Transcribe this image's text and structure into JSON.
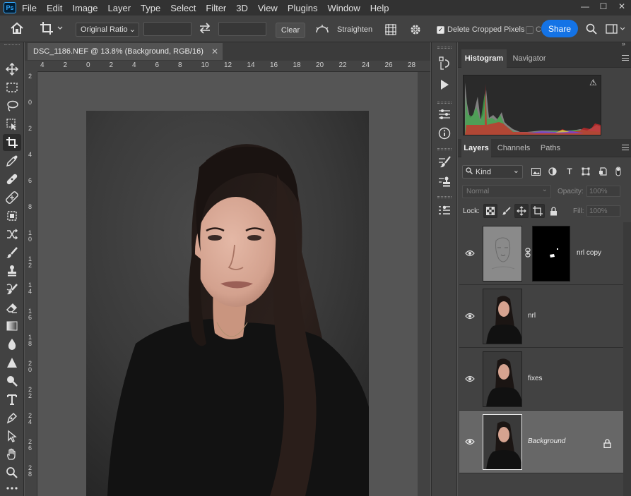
{
  "app": {
    "logo": "Ps",
    "menu": [
      "File",
      "Edit",
      "Image",
      "Layer",
      "Type",
      "Select",
      "Filter",
      "3D",
      "View",
      "Plugins",
      "Window",
      "Help"
    ],
    "window_controls": [
      "—",
      "☐",
      "✕"
    ]
  },
  "options": {
    "ratio_select": "Original Ratio",
    "clear_label": "Clear",
    "straighten_label": "Straighten",
    "delete_cropped_label": "Delete Cropped Pixels",
    "content_aware_stub": "C",
    "share_label": "Share",
    "delete_cropped_checked": true
  },
  "document": {
    "tab_title": "DSC_1186.NEF @ 13.8% (Background, RGB/16)",
    "tab_close": "✕",
    "ruler_top": [
      "4",
      "2",
      "0",
      "2",
      "4",
      "6",
      "8",
      "10",
      "12",
      "14",
      "16",
      "18",
      "20",
      "22",
      "24",
      "26",
      "28"
    ],
    "ruler_left": [
      "2",
      "0",
      "2",
      "4",
      "6",
      "8",
      "1\n0",
      "1\n2",
      "1\n4",
      "1\n6",
      "1\n8",
      "2\n0",
      "2\n2",
      "2\n4",
      "2\n6",
      "2\n8"
    ]
  },
  "histogram_panel": {
    "tabs": [
      "Histogram",
      "Navigator"
    ],
    "active_tab": "Histogram",
    "warning_glyph": "⚠"
  },
  "layers_panel": {
    "tabs": [
      "Layers",
      "Channels",
      "Paths"
    ],
    "active_tab": "Layers",
    "filter_kind": "Kind",
    "blend_mode": "Normal",
    "opacity_label": "Opacity:",
    "opacity_value": "100%",
    "lock_label": "Lock:",
    "fill_label": "Fill:",
    "fill_value": "100%",
    "layers": [
      {
        "name": "nrl copy",
        "visible": true,
        "has_mask": true,
        "selected": false
      },
      {
        "name": "nrl",
        "visible": true,
        "has_mask": false,
        "selected": false
      },
      {
        "name": "fixes",
        "visible": true,
        "has_mask": false,
        "selected": false
      },
      {
        "name": "Background",
        "visible": true,
        "has_mask": false,
        "selected": true,
        "locked": true
      }
    ]
  },
  "colors": {
    "accent": "#1473e6",
    "ps_blue": "#31a8ff",
    "menubar": "#323232",
    "panel": "#424242",
    "canvas": "#555555"
  }
}
